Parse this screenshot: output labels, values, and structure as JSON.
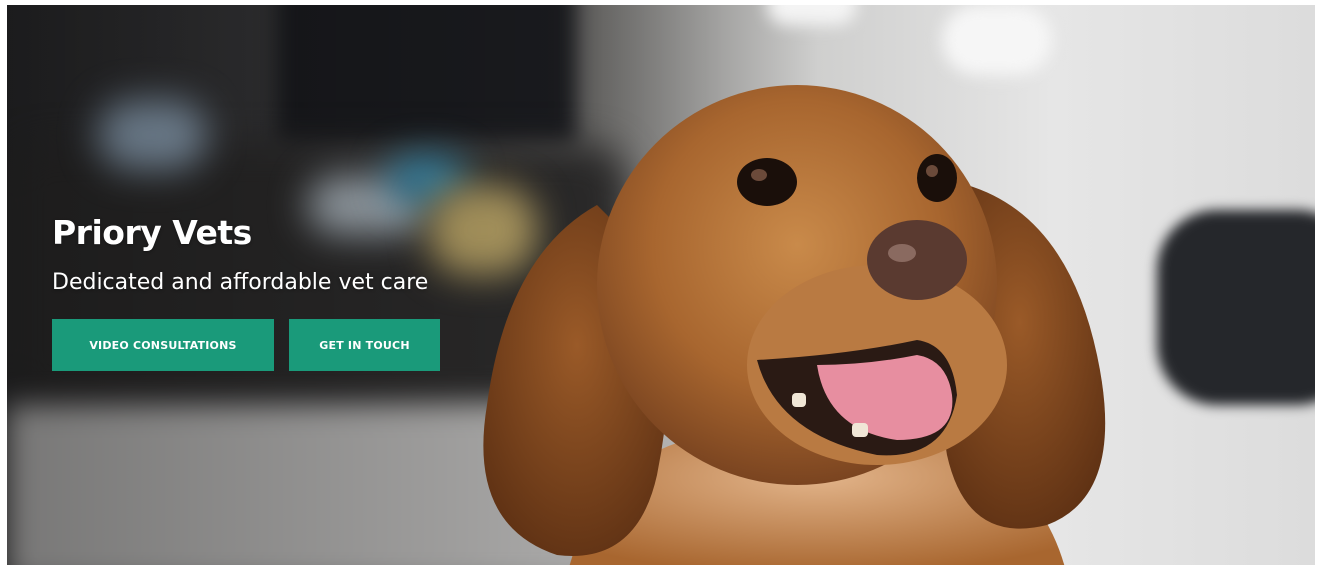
{
  "hero": {
    "title": "Priory Vets",
    "subtitle": "Dedicated and affordable vet care",
    "background_image": "dog-in-vet-clinic",
    "buttons": [
      {
        "label": "VIDEO CONSULTATIONS"
      },
      {
        "label": "GET IN TOUCH"
      }
    ]
  },
  "colors": {
    "button_bg": "#1a9a7a",
    "button_text": "#ffffff",
    "hero_text": "#ffffff"
  }
}
